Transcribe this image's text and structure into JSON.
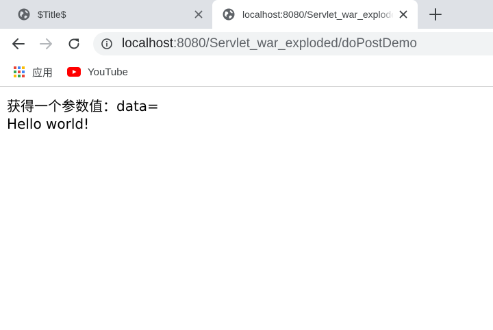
{
  "tabs": [
    {
      "title": "$Title$",
      "active": false
    },
    {
      "title": "localhost:8080/Servlet_war_exploded/doPostDemo",
      "active": true
    }
  ],
  "address_bar": {
    "host": "localhost",
    "path": ":8080/Servlet_war_exploded/doPostDemo"
  },
  "bookmarks": [
    {
      "label": "应用",
      "icon": "apps-grid-icon"
    },
    {
      "label": "YouTube",
      "icon": "youtube-icon"
    }
  ],
  "page": {
    "line1": "获得一个参数值：data=",
    "line2": "Hello world!"
  },
  "colors": {
    "tabstrip": "#dee1e6",
    "omnibox": "#f1f3f4",
    "youtube_red": "#ff0000"
  }
}
